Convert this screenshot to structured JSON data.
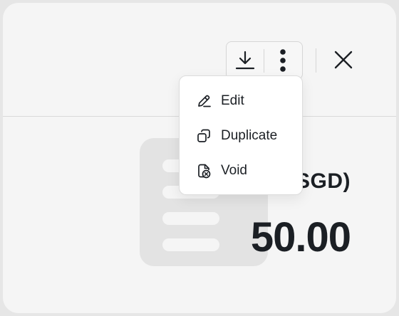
{
  "invoice": {
    "currency_label": "(SGD)",
    "amount": "50.00"
  },
  "toolbar": {
    "download_icon": "download-icon",
    "more_icon": "more-vertical-icon",
    "close_icon": "close-icon"
  },
  "menu": {
    "items": [
      {
        "label": "Edit",
        "icon": "pencil-icon"
      },
      {
        "label": "Duplicate",
        "icon": "copy-icon"
      },
      {
        "label": "Void",
        "icon": "void-icon"
      }
    ]
  },
  "colors": {
    "text": "#1b1f24",
    "background": "#f5f5f5",
    "menu_bg": "#ffffff",
    "border": "#d6d6d6",
    "illustration": "#e3e3e3"
  }
}
